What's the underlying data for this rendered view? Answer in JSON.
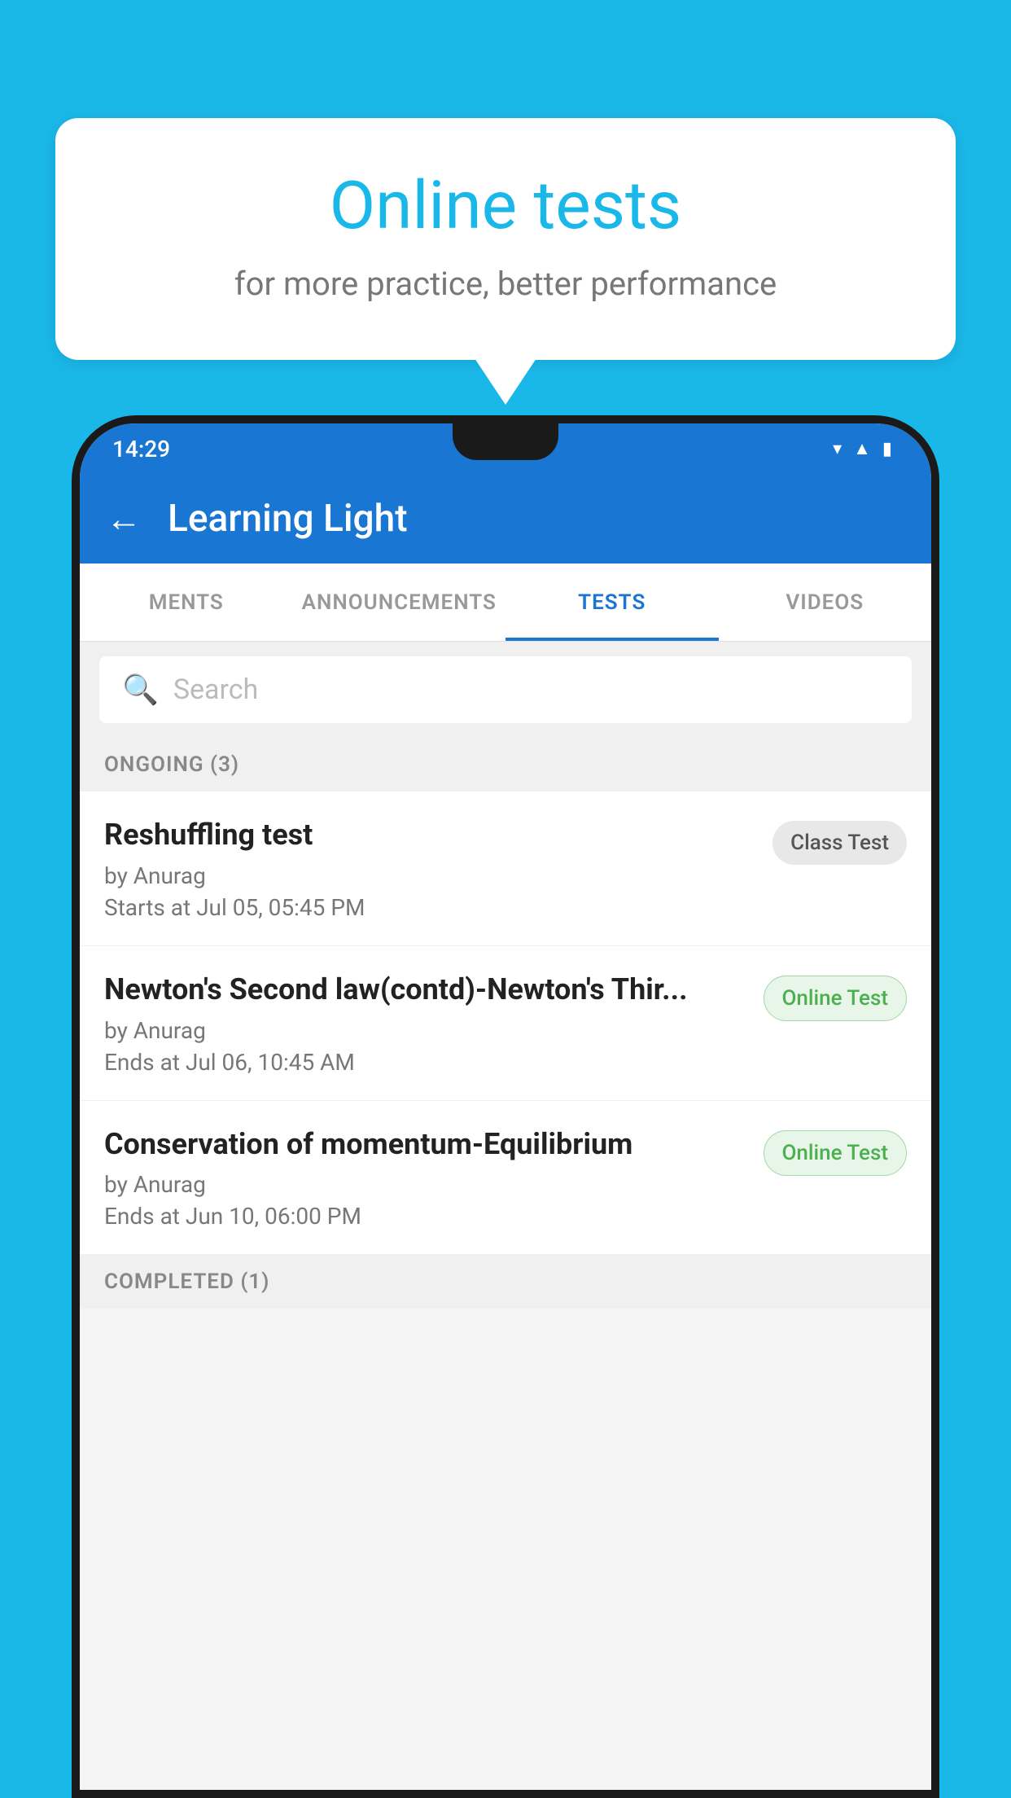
{
  "background_color": "#1ab8e8",
  "speech_bubble": {
    "title": "Online tests",
    "subtitle": "for more practice, better performance"
  },
  "phone": {
    "status_bar": {
      "time": "14:29",
      "icons": [
        "wifi",
        "signal",
        "battery"
      ]
    },
    "app_bar": {
      "title": "Learning Light",
      "back_label": "←"
    },
    "tabs": [
      {
        "label": "MENTS",
        "active": false
      },
      {
        "label": "ANNOUNCEMENTS",
        "active": false
      },
      {
        "label": "TESTS",
        "active": true
      },
      {
        "label": "VIDEOS",
        "active": false
      }
    ],
    "search": {
      "placeholder": "Search"
    },
    "sections": [
      {
        "header": "ONGOING (3)",
        "items": [
          {
            "name": "Reshuffling test",
            "author": "by Anurag",
            "time_label": "Starts at  Jul 05, 05:45 PM",
            "badge": "Class Test",
            "badge_type": "class"
          },
          {
            "name": "Newton's Second law(contd)-Newton's Thir...",
            "author": "by Anurag",
            "time_label": "Ends at  Jul 06, 10:45 AM",
            "badge": "Online Test",
            "badge_type": "online"
          },
          {
            "name": "Conservation of momentum-Equilibrium",
            "author": "by Anurag",
            "time_label": "Ends at  Jun 10, 06:00 PM",
            "badge": "Online Test",
            "badge_type": "online"
          }
        ]
      }
    ],
    "completed_header": "COMPLETED (1)"
  }
}
